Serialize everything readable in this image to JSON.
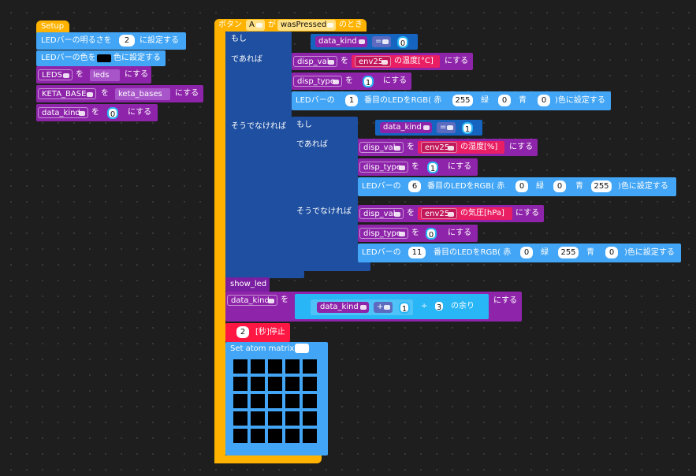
{
  "setup": {
    "hat_label": "Setup",
    "brightness": {
      "prefix": "LEDバーの明るさを",
      "value": "2",
      "suffix": "に設定する"
    },
    "color": {
      "prefix": "LEDバーの色を",
      "suffix": "色に設定する",
      "swatch_color": "#000000"
    },
    "leds": {
      "var": "LEDS",
      "wo": "を",
      "value": "leds",
      "suffix": "にする"
    },
    "keta": {
      "var": "KETA_BASE",
      "wo": "を",
      "value": "keta_bases",
      "suffix": "にする"
    },
    "data_kind": {
      "var": "data_kind",
      "wo": "を",
      "value": "0",
      "suffix": "にする"
    }
  },
  "event": {
    "prefix": "ボタン",
    "button": "A",
    "ga": "が",
    "action": "wasPressed",
    "suffix": "のとき"
  },
  "if1": {
    "moshi": "もし",
    "deareba": "であれば",
    "else": "そうでなければ",
    "cond": {
      "var": "data_kind",
      "op": "=",
      "value": "0"
    },
    "set_val": {
      "var": "disp_val",
      "wo": "を",
      "sensor": "env25",
      "reading": "の温度[°C]",
      "suffix": "にする"
    },
    "set_type": {
      "var": "disp_type",
      "wo": "を",
      "value": "1",
      "suffix": "にする"
    },
    "rgb": {
      "prefix": "LEDバーの",
      "index": "1",
      "mid": "番目のLEDをRGB( 赤",
      "r": "255",
      "g_label": "緑",
      "g": "0",
      "b_label": "青",
      "b": "0",
      "suffix": ")色に設定する"
    }
  },
  "if2": {
    "moshi": "もし",
    "deareba": "であれば",
    "else": "そうでなければ",
    "cond": {
      "var": "data_kind",
      "op": "=",
      "value": "1"
    },
    "set_val": {
      "var": "disp_val",
      "wo": "を",
      "sensor": "env25",
      "reading": "の湿度[%]",
      "suffix": "にする"
    },
    "set_type": {
      "var": "disp_type",
      "wo": "を",
      "value": "1",
      "suffix": "にする"
    },
    "rgb": {
      "prefix": "LEDバーの",
      "index": "6",
      "mid": "番目のLEDをRGB( 赤",
      "r": "0",
      "g_label": "緑",
      "g": "0",
      "b_label": "青",
      "b": "255",
      "suffix": ")色に設定する"
    },
    "else_val": {
      "var": "disp_val",
      "wo": "を",
      "sensor": "env25",
      "reading": "の気圧[hPa]",
      "suffix": "にする"
    },
    "else_type": {
      "var": "disp_type",
      "wo": "を",
      "value": "0",
      "suffix": "にする"
    },
    "else_rgb": {
      "prefix": "LEDバーの",
      "index": "11",
      "mid": "番目のLEDをRGB( 赤",
      "r": "0",
      "g_label": "緑",
      "g": "255",
      "b_label": "青",
      "b": "0",
      "suffix": ")色に設定する"
    }
  },
  "show_led": {
    "label": "show_led"
  },
  "modulo": {
    "var": "data_kind",
    "wo": "を",
    "inner_var": "data_kind",
    "op": "+",
    "add": "1",
    "div": "÷",
    "mod": "3",
    "amari": "の余り",
    "suffix": "にする"
  },
  "wait": {
    "value": "2",
    "suffix": "[秒]停止"
  },
  "matrix": {
    "label": "Set atom matrix",
    "rows": 5,
    "cols": 5,
    "pixel_color": "#000000"
  },
  "colors": {
    "hat": "#ffb300",
    "led": "#42a5f5",
    "var": "#8e24aa",
    "logic": "#1e4fa0",
    "math": "#29b6f6",
    "env": "#e91e63",
    "wait": "#ff1744",
    "func": "#7b1fa2"
  }
}
